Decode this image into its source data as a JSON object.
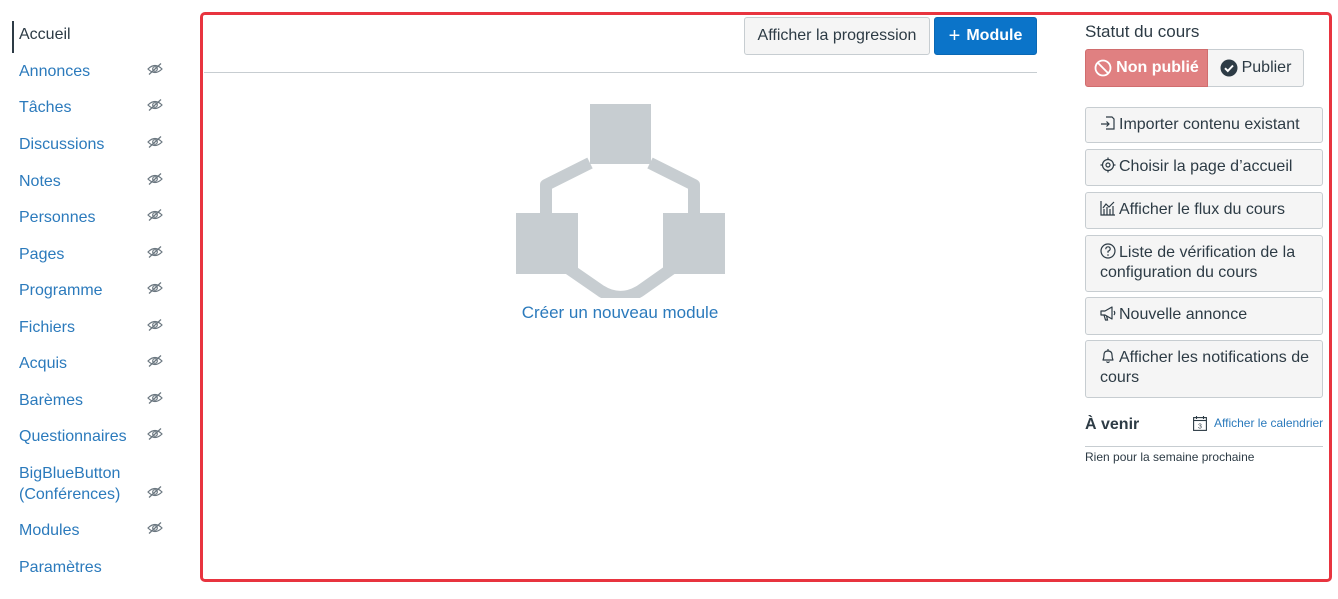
{
  "nav": {
    "items": [
      {
        "label": "Accueil",
        "active": true,
        "hidden_icon": false
      },
      {
        "label": "Annonces",
        "hidden_icon": true
      },
      {
        "label": "Tâches",
        "hidden_icon": true
      },
      {
        "label": "Discussions",
        "hidden_icon": true
      },
      {
        "label": "Notes",
        "hidden_icon": true
      },
      {
        "label": "Personnes",
        "hidden_icon": true
      },
      {
        "label": "Pages",
        "hidden_icon": true
      },
      {
        "label": "Programme",
        "hidden_icon": true
      },
      {
        "label": "Fichiers",
        "hidden_icon": true
      },
      {
        "label": "Acquis",
        "hidden_icon": true
      },
      {
        "label": "Barèmes",
        "hidden_icon": true
      },
      {
        "label": "Questionnaires",
        "hidden_icon": true
      },
      {
        "label": "BigBlueButton",
        "label2": "(Conférences)",
        "hidden_icon": true
      },
      {
        "label": "Modules",
        "hidden_icon": true
      },
      {
        "label": "Paramètres",
        "hidden_icon": false
      }
    ]
  },
  "header": {
    "progress_button": "Afficher la progression",
    "module_button_plus": "+",
    "module_button": "Module"
  },
  "empty_state": {
    "create_link": "Créer un nouveau module"
  },
  "sidebar": {
    "status_title": "Statut du cours",
    "unpublished": "Non publié",
    "publish": "Publier",
    "buttons": [
      {
        "label": "Importer contenu existant",
        "icon": "import-icon"
      },
      {
        "label": "Choisir la page d’accueil",
        "icon": "target-icon"
      },
      {
        "label": "Afficher le flux du cours",
        "icon": "stream-icon"
      },
      {
        "label": "Liste de vérification de la configuration du cours",
        "icon": "question-circle-icon"
      },
      {
        "label": "Nouvelle annonce",
        "icon": "megaphone-icon"
      },
      {
        "label": "Afficher les notifications de cours",
        "icon": "bell-icon"
      }
    ],
    "upcoming_title": "À venir",
    "calendar_icon_day": "3",
    "calendar_link": "Afficher le calendrier",
    "upcoming_empty": "Rien pour la semaine prochaine"
  },
  "colors": {
    "link": "#2b7abc",
    "primary": "#0b74c9",
    "unpublished": "#e08081",
    "highlight_frame": "#e8343f",
    "placeholder_graphic": "#c7cdd1"
  }
}
